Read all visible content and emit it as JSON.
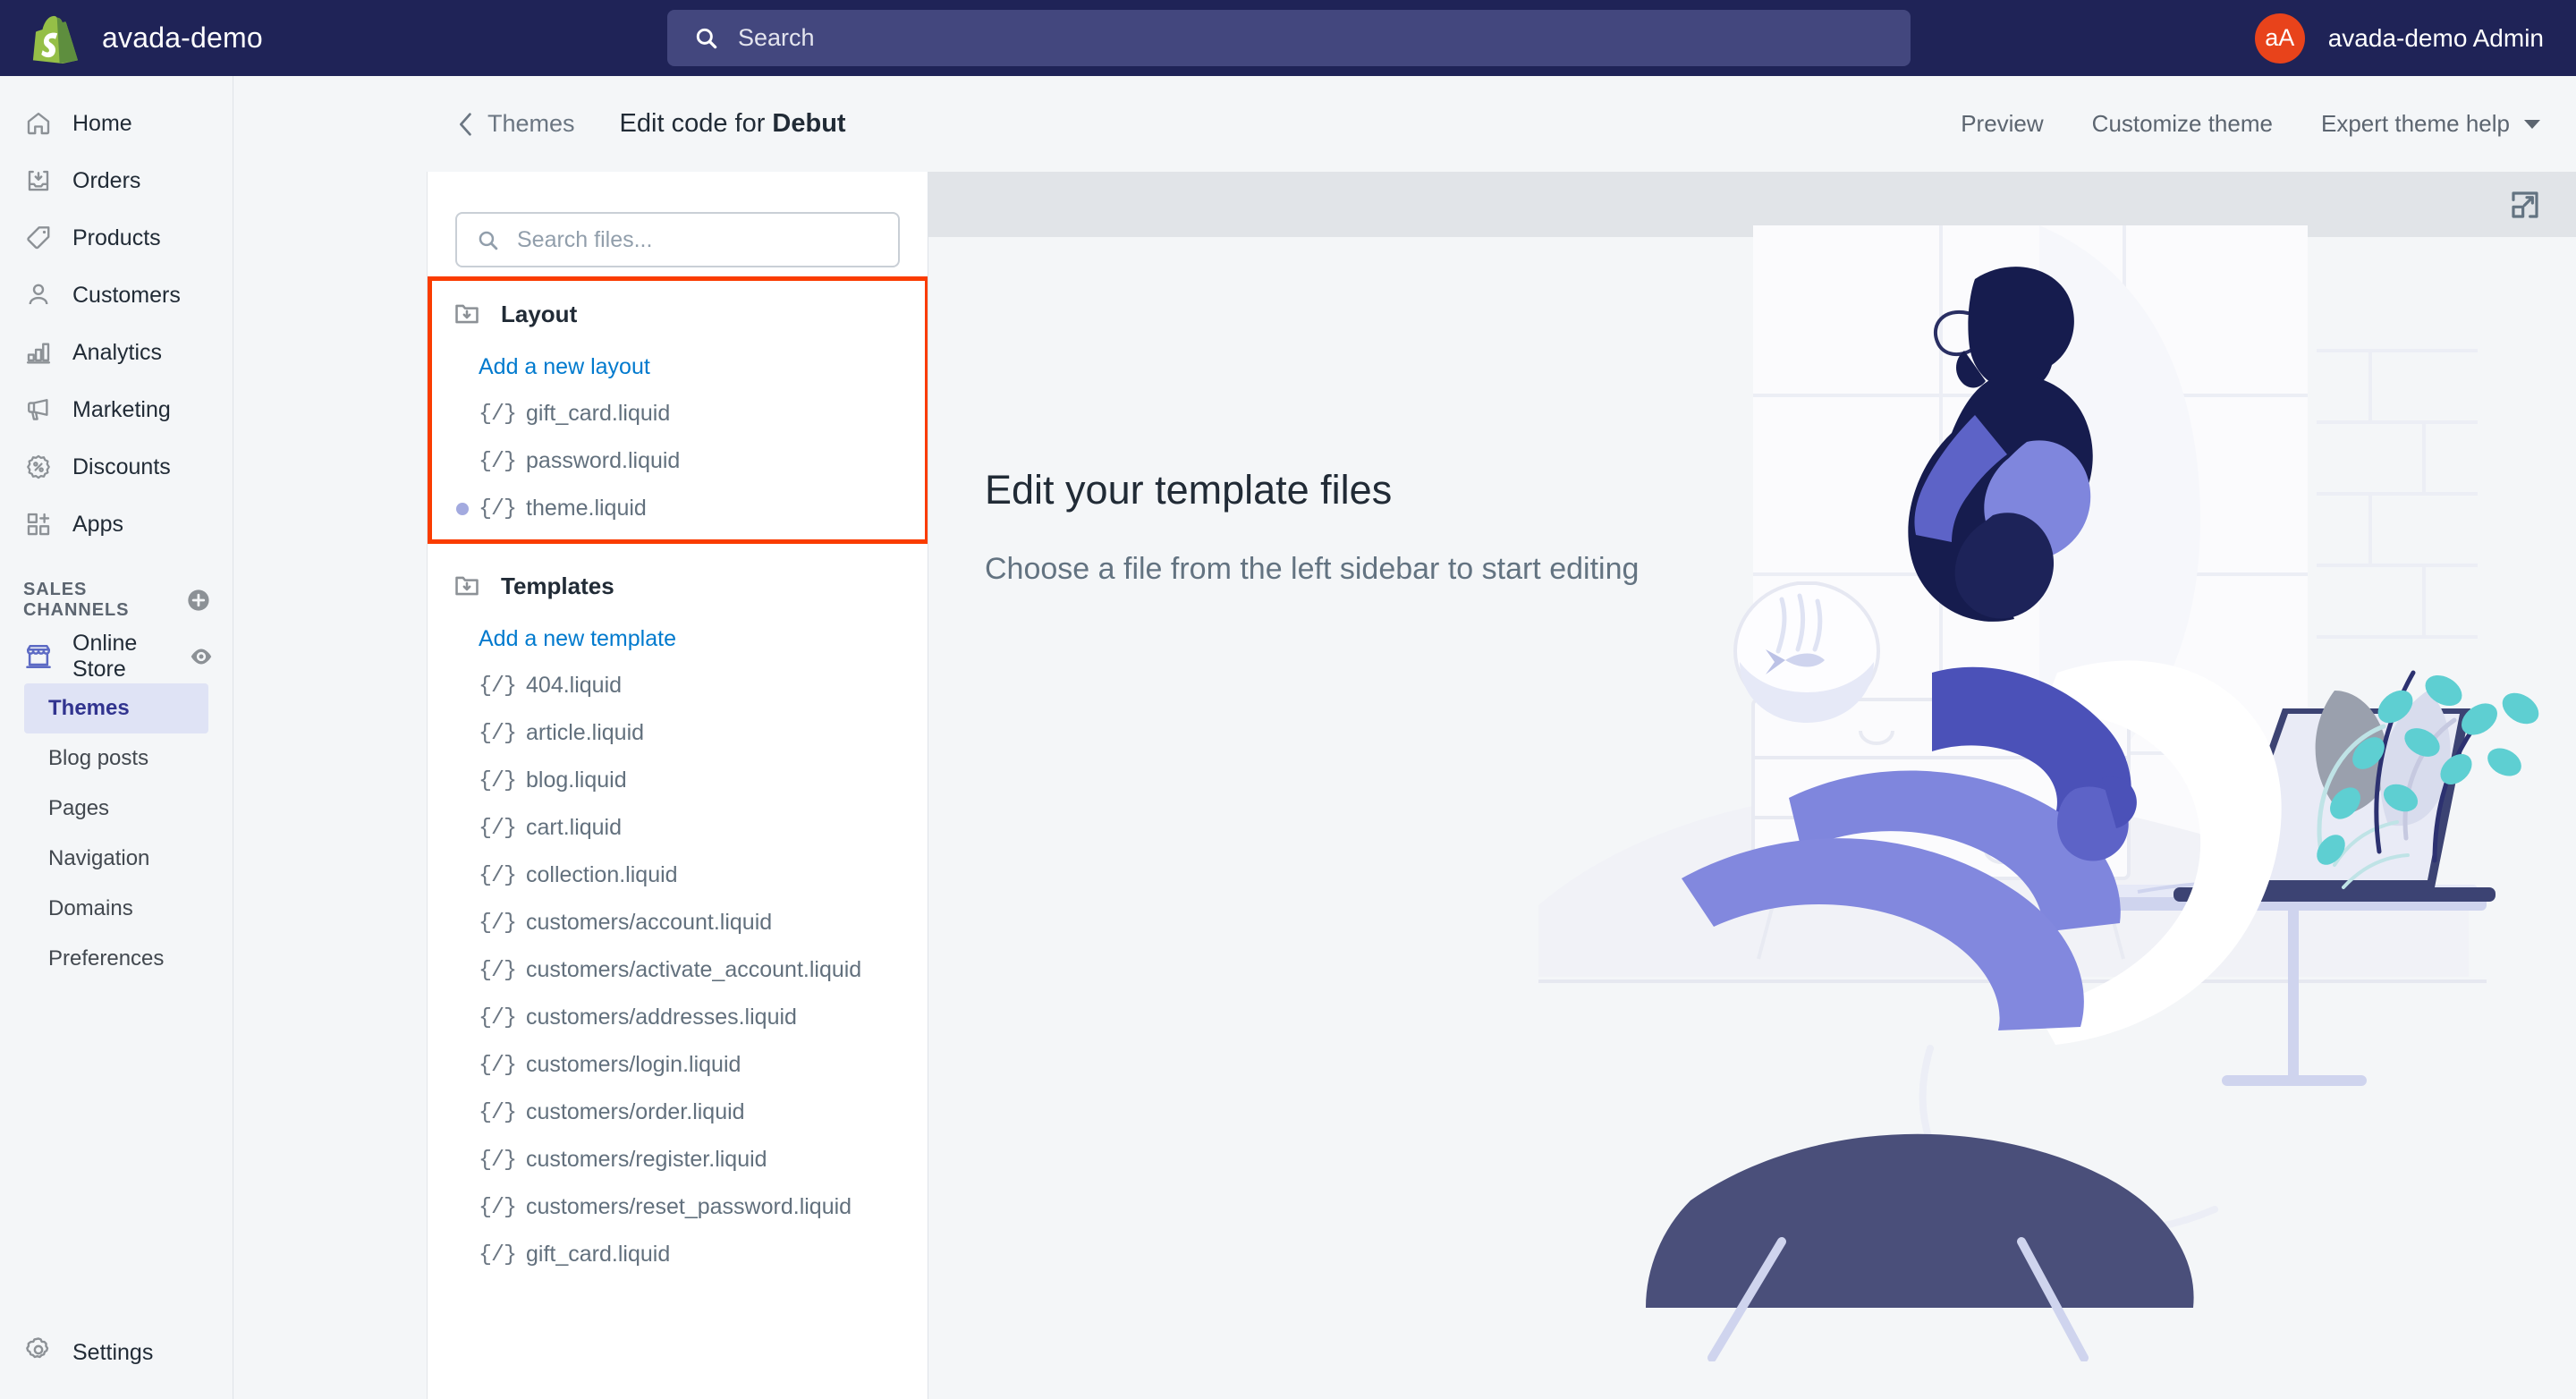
{
  "topbar": {
    "logo_icon": "shopify-bag-icon",
    "store_name": "avada-demo",
    "search": {
      "icon": "search-icon",
      "placeholder": "Search",
      "value": ""
    },
    "user": {
      "avatar_initials": "aA",
      "name": "avada-demo Admin",
      "avatar_color": "#e8431b"
    }
  },
  "sidebar": {
    "items": [
      {
        "icon": "home-icon",
        "label": "Home"
      },
      {
        "icon": "orders-inbox-icon",
        "label": "Orders"
      },
      {
        "icon": "products-tag-icon",
        "label": "Products"
      },
      {
        "icon": "customers-person-icon",
        "label": "Customers"
      },
      {
        "icon": "analytics-bar-chart-icon",
        "label": "Analytics"
      },
      {
        "icon": "marketing-megaphone-icon",
        "label": "Marketing"
      },
      {
        "icon": "discounts-percent-icon",
        "label": "Discounts"
      },
      {
        "icon": "apps-grid-plus-icon",
        "label": "Apps"
      }
    ],
    "sales_channels_heading": "SALES CHANNELS",
    "add_channel_icon": "plus-circle-icon",
    "online_store": {
      "icon": "storefront-icon",
      "label": "Online Store",
      "preview_icon": "eye-icon"
    },
    "sub_items": [
      {
        "label": "Themes",
        "active": true
      },
      {
        "label": "Blog posts",
        "active": false
      },
      {
        "label": "Pages",
        "active": false
      },
      {
        "label": "Navigation",
        "active": false
      },
      {
        "label": "Domains",
        "active": false
      },
      {
        "label": "Preferences",
        "active": false
      }
    ],
    "settings": {
      "icon": "gear-icon",
      "label": "Settings"
    }
  },
  "header": {
    "back_icon": "chevron-left-icon",
    "breadcrumb": "Themes",
    "title_prefix": "Edit code for ",
    "title_theme": "Debut",
    "actions": [
      {
        "label": "Preview",
        "caret": false
      },
      {
        "label": "Customize theme",
        "caret": false
      },
      {
        "label": "Expert theme help",
        "caret": true
      }
    ]
  },
  "file_panel": {
    "search": {
      "icon": "search-icon",
      "placeholder": "Search files...",
      "value": ""
    },
    "groups": [
      {
        "icon": "folder-download-icon",
        "name": "Layout",
        "add_label": "Add a new layout",
        "highlighted": true,
        "files": [
          {
            "icon": "code-braces-icon",
            "name": "gift_card.liquid",
            "modified": false
          },
          {
            "icon": "code-braces-icon",
            "name": "password.liquid",
            "modified": false
          },
          {
            "icon": "code-braces-icon",
            "name": "theme.liquid",
            "modified": true
          }
        ]
      },
      {
        "icon": "folder-download-icon",
        "name": "Templates",
        "add_label": "Add a new template",
        "highlighted": false,
        "files": [
          {
            "icon": "code-braces-icon",
            "name": "404.liquid",
            "modified": false
          },
          {
            "icon": "code-braces-icon",
            "name": "article.liquid",
            "modified": false
          },
          {
            "icon": "code-braces-icon",
            "name": "blog.liquid",
            "modified": false
          },
          {
            "icon": "code-braces-icon",
            "name": "cart.liquid",
            "modified": false
          },
          {
            "icon": "code-braces-icon",
            "name": "collection.liquid",
            "modified": false
          },
          {
            "icon": "code-braces-icon",
            "name": "customers/account.liquid",
            "modified": false
          },
          {
            "icon": "code-braces-icon",
            "name": "customers/activate_account.liquid",
            "modified": false
          },
          {
            "icon": "code-braces-icon",
            "name": "customers/addresses.liquid",
            "modified": false
          },
          {
            "icon": "code-braces-icon",
            "name": "customers/login.liquid",
            "modified": false
          },
          {
            "icon": "code-braces-icon",
            "name": "customers/order.liquid",
            "modified": false
          },
          {
            "icon": "code-braces-icon",
            "name": "customers/register.liquid",
            "modified": false
          },
          {
            "icon": "code-braces-icon",
            "name": "customers/reset_password.liquid",
            "modified": false
          },
          {
            "icon": "code-braces-icon",
            "name": "gift_card.liquid",
            "modified": false
          }
        ]
      }
    ]
  },
  "content": {
    "expand_icon": "expand-fullscreen-icon",
    "empty_title": "Edit your template files",
    "empty_subtitle": "Choose a file from the left sidebar to start editing",
    "illustration": "person-working-at-desk-illustration"
  },
  "colors": {
    "topbar_bg": "#1f2357",
    "accent_link": "#007ace",
    "highlight_border": "#fa3c00",
    "active_nav_bg": "#dfe3f5",
    "active_nav_text": "#31348f",
    "modified_dot": "#a3aadf",
    "toolbar_bg": "#e1e4e8"
  }
}
